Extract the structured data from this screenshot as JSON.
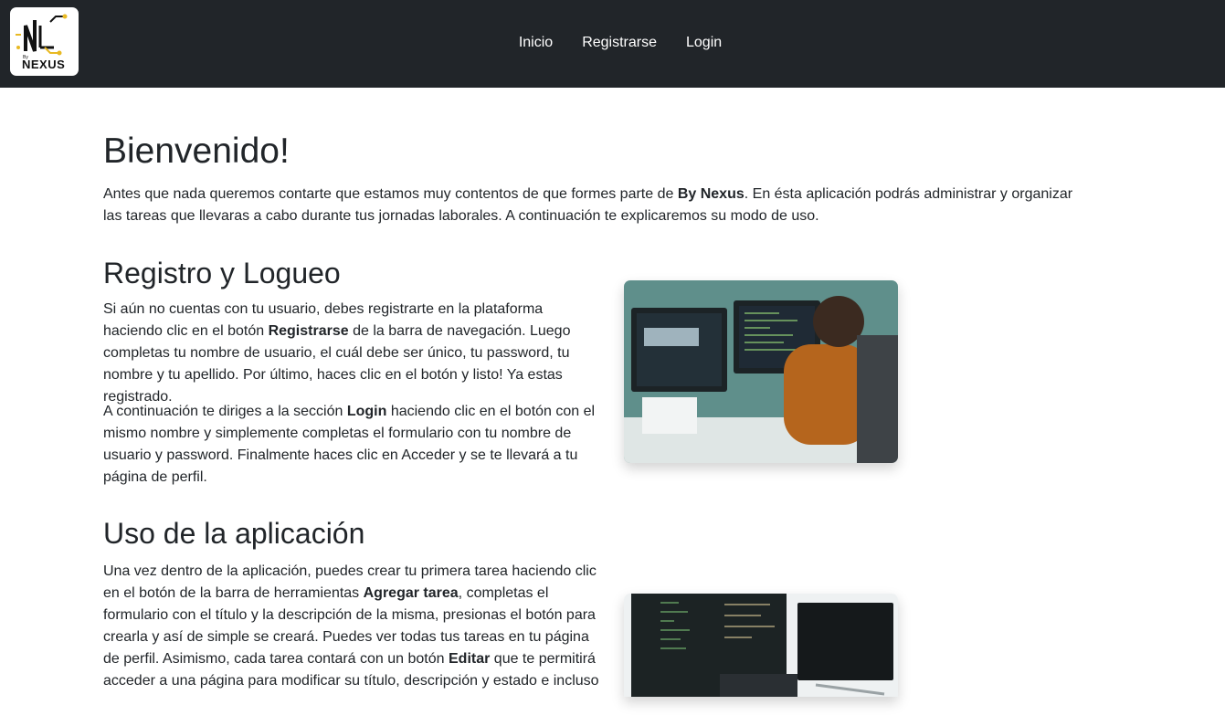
{
  "brand": {
    "logo_text": "NEXUS",
    "logo_small": "By"
  },
  "nav": {
    "items": [
      {
        "label": "Inicio"
      },
      {
        "label": "Registrarse"
      },
      {
        "label": "Login"
      }
    ]
  },
  "main": {
    "title": "Bienvenido!",
    "intro": {
      "t1": "Antes que nada queremos contarte que estamos muy contentos de que formes parte de ",
      "b1": "By Nexus",
      "t2": ". En ésta aplicación podrás administrar y organizar las tareas que llevaras a cabo durante tus jornadas laborales. A continuación te explicaremos su modo de uso."
    },
    "registro": {
      "heading": "Registro y Logueo",
      "p1": {
        "t1": "Si aún no cuentas con tu usuario, debes registrarte en la plataforma haciendo clic en el botón ",
        "b1": "Registrarse",
        "t2": " de la barra de navegación. Luego completas tu nombre de usuario, el cuál debe ser único, tu password, tu nombre y tu apellido. Por último, haces clic en el botón y listo! Ya estas registrado."
      },
      "p2": {
        "t1": "A continuación te diriges a la sección ",
        "b1": "Login",
        "t2": " haciendo clic en el botón con el mismo nombre y simplemente completas el formulario con tu nombre de usuario y password. Finalmente haces clic en Acceder y se te llevará a tu página de perfil."
      }
    },
    "uso": {
      "heading": "Uso de la aplicación",
      "p1": {
        "t1": "Una vez dentro de la aplicación, puedes crear tu primera tarea haciendo clic en el botón de la barra de herramientas ",
        "b1": "Agregar tarea",
        "t2": ", completas el formulario con el título y la descripción de la misma, presionas el botón para crearla y así de simple se creará. Puedes ver todas tus tareas en tu página de perfil. Asimismo, cada tarea contará con un botón ",
        "b2": "Editar",
        "t3": " que te permitirá acceder a una página para modificar su título, descripción y estado e incluso"
      }
    }
  }
}
